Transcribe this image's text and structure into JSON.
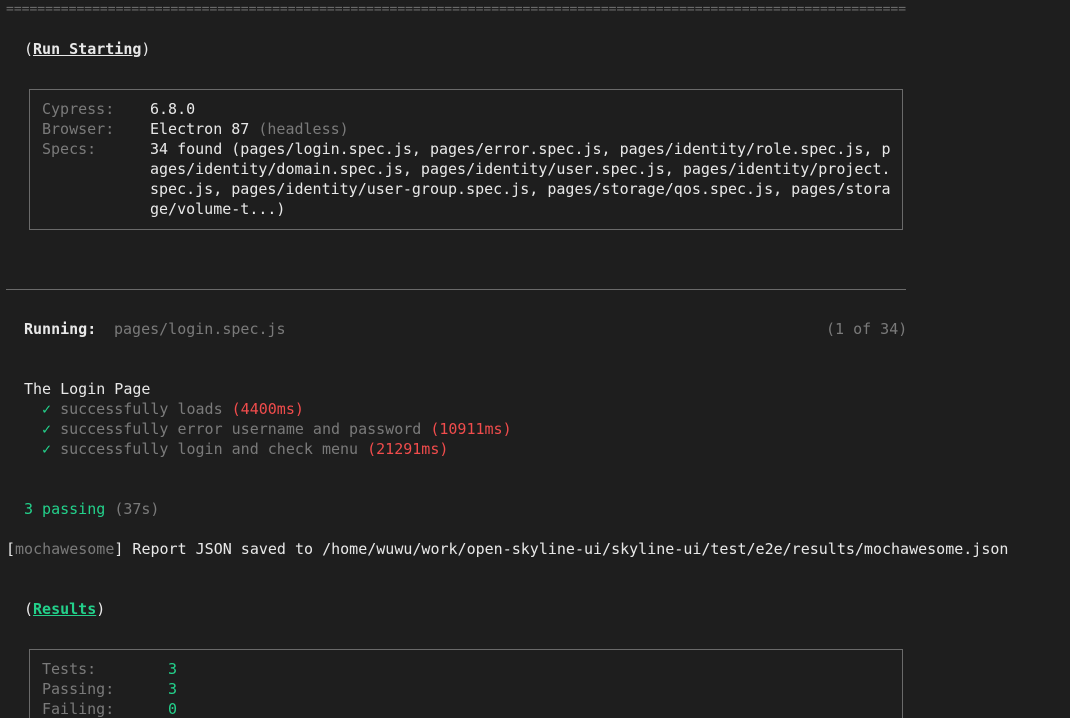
{
  "header": {
    "equals_rule": "=======================================================================================================================",
    "run_starting": "Run Starting"
  },
  "run_info": {
    "cypress_label": "Cypress:",
    "cypress_value": "6.8.0",
    "browser_label": "Browser:",
    "browser_value": "Electron 87",
    "browser_mode": "(headless)",
    "specs_label": "Specs:",
    "specs_lines": [
      "34 found (pages/login.spec.js, pages/error.spec.js, pages/identity/role.spec.js, p",
      "ages/identity/domain.spec.js, pages/identity/user.spec.js, pages/identity/project.",
      "spec.js, pages/identity/user-group.spec.js, pages/storage/qos.spec.js, pages/stora",
      "ge/volume-t...)"
    ]
  },
  "running": {
    "label": "Running:",
    "spec": "pages/login.spec.js",
    "progress": "(1 of 34)"
  },
  "suite": {
    "title": "The Login Page",
    "check": "✓",
    "tests": [
      {
        "name": "successfully loads",
        "duration": "(4400ms)"
      },
      {
        "name": "successfully error username and password",
        "duration": "(10911ms)"
      },
      {
        "name": "successfully login and check menu",
        "duration": "(21291ms)"
      }
    ]
  },
  "summary": {
    "passing": "3 passing",
    "time": "(37s)"
  },
  "report": {
    "bracket_open": "[",
    "reporter": "mochawesome",
    "bracket_close": "]",
    "message": " Report JSON saved to /home/wuwu/work/open-skyline-ui/skyline-ui/test/e2e/results/mochawesome.json"
  },
  "results": {
    "heading": "Results",
    "rows": [
      {
        "label": "Tests:",
        "value": "3"
      },
      {
        "label": "Passing:",
        "value": "3"
      },
      {
        "label": "Failing:",
        "value": "0"
      }
    ]
  },
  "colors": {
    "background": "#1e1e1e",
    "green": "#23d18b",
    "red": "#f14c4c",
    "dim": "#7a7a7a"
  }
}
